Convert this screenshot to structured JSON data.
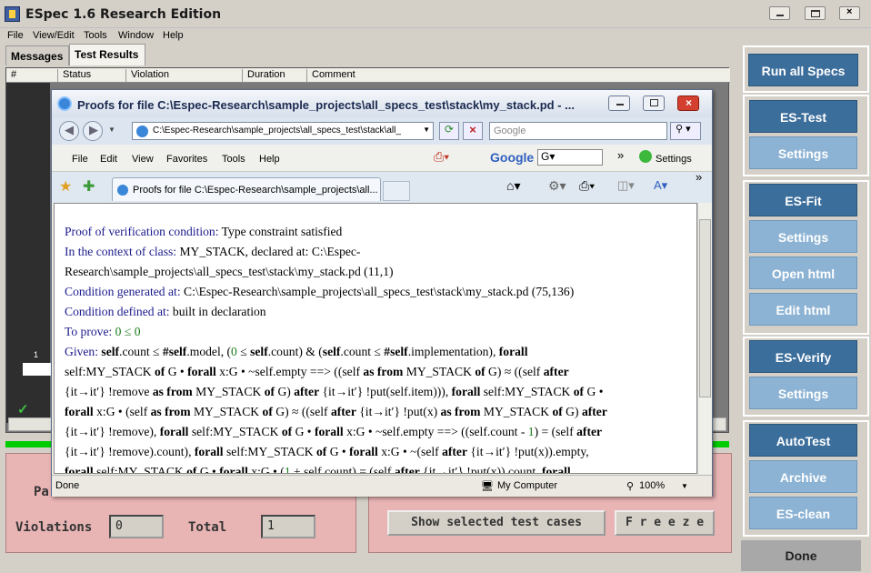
{
  "app": {
    "title": "ESpec 1.6 Research Edition",
    "menu": [
      "File",
      "View/Edit",
      "Tools",
      "Window",
      "Help"
    ]
  },
  "tabs": [
    {
      "label": "Messages"
    },
    {
      "label": "Test Results"
    }
  ],
  "grid": {
    "columns": [
      "#",
      "Status",
      "Violation",
      "Duration",
      "Comment"
    ],
    "rows": [
      {
        "index": "1"
      }
    ]
  },
  "stats": {
    "passed_label": "Pa",
    "violations_label": "Violations",
    "violations_value": "0",
    "total_label": "Total",
    "total_value": "1"
  },
  "bottom_buttons": {
    "show_selected": "Show selected test cases",
    "freeze": "F r e e z e"
  },
  "sidebar": {
    "run_all": "Run all Specs",
    "es_test": "ES-Test",
    "settings1": "Settings",
    "es_fit": "ES-Fit",
    "settings2": "Settings",
    "open_html": "Open html",
    "edit_html": "Edit html",
    "es_verify": "ES-Verify",
    "settings3": "Settings",
    "autotest": "AutoTest",
    "archive": "Archive",
    "es_clean": "ES-clean",
    "done": "Done"
  },
  "browser": {
    "title": "Proofs for file C:\\Espec-Research\\sample_projects\\all_specs_test\\stack\\my_stack.pd - ...",
    "address": "C:\\Espec-Research\\sample_projects\\all_specs_test\\stack\\all_",
    "search_placeholder": "Google",
    "menu": [
      "File",
      "Edit",
      "View",
      "Favorites",
      "Tools",
      "Help"
    ],
    "google_label": "Google",
    "settings_label": "Settings",
    "tab_label": "Proofs for file C:\\Espec-Research\\sample_projects\\all...",
    "status_text": "Done",
    "zone": "My Computer",
    "zoom": "100%",
    "doc": {
      "l1k": "Proof of verification condition:",
      "l1": " Type constraint satisfied",
      "l2k": "In the context of class:",
      "l2": " MY_STACK, declared at: C:\\Espec-",
      "l3": "Research\\sample_projects\\all_specs_test\\stack\\my_stack.pd (11,1)",
      "l4k": "Condition generated at:",
      "l4": " C:\\Espec-Research\\sample_projects\\all_specs_test\\stack\\my_stack.pd (75,136)",
      "l5k": "Condition defined at:",
      "l5": " built in declaration",
      "l6k": "To prove:",
      "l6": " 0 ≤ 0",
      "given_label": "Given:"
    }
  }
}
